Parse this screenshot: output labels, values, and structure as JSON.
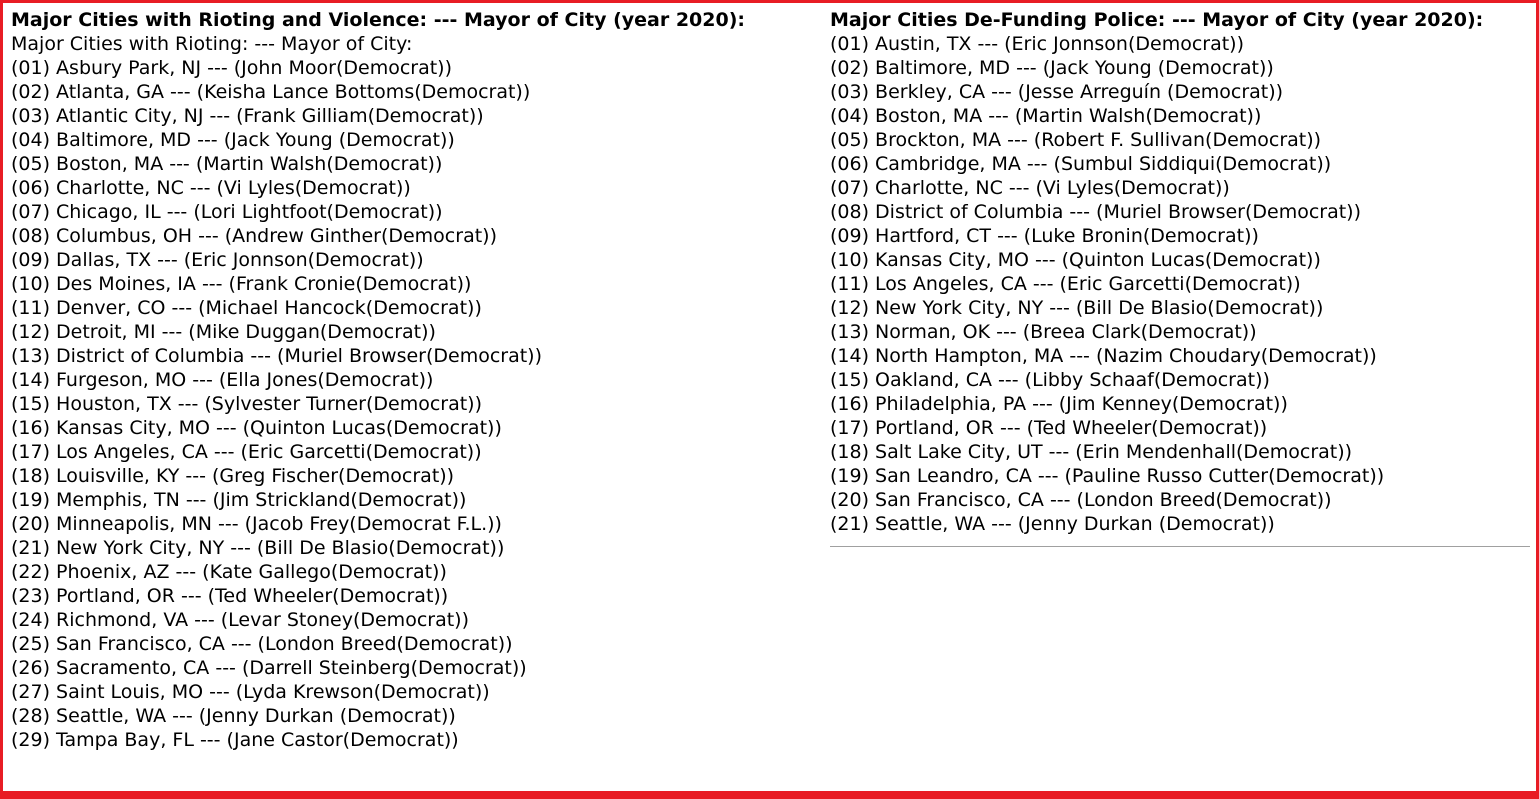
{
  "colors": {
    "frame_border": "#e81c24",
    "divider": "#a0a0a0"
  },
  "left": {
    "heading": "Major Cities with Rioting and Violence: --- Mayor of City (year 2020):",
    "subheading": "Major Cities with Rioting: --- Mayor of City:",
    "items": [
      "(01) Asbury Park, NJ --- (John Moor(Democrat))",
      "(02) Atlanta, GA --- (Keisha Lance Bottoms(Democrat))",
      "(03) Atlantic City, NJ --- (Frank Gilliam(Democrat))",
      "(04) Baltimore, MD --- (Jack Young (Democrat))",
      "(05) Boston, MA --- (Martin Walsh(Democrat))",
      "(06) Charlotte, NC --- (Vi Lyles(Democrat))",
      "(07) Chicago, IL --- (Lori Lightfoot(Democrat))",
      "(08) Columbus, OH --- (Andrew Ginther(Democrat))",
      "(09) Dallas, TX --- (Eric Jonnson(Democrat))",
      "(10) Des Moines, IA --- (Frank Cronie(Democrat))",
      "(11) Denver, CO --- (Michael Hancock(Democrat))",
      "(12) Detroit, MI --- (Mike Duggan(Democrat))",
      "(13) District of Columbia --- (Muriel Browser(Democrat))",
      "(14) Furgeson, MO --- (Ella Jones(Democrat))",
      "(15) Houston, TX --- (Sylvester Turner(Democrat))",
      "(16) Kansas City, MO --- (Quinton Lucas(Democrat))",
      "(17) Los Angeles, CA --- (Eric Garcetti(Democrat))",
      "(18) Louisville, KY --- (Greg Fischer(Democrat))",
      "(19) Memphis, TN --- (Jim Strickland(Democrat))",
      "(20) Minneapolis, MN --- (Jacob Frey(Democrat F.L.))",
      "(21) New York City, NY --- (Bill De Blasio(Democrat))",
      "(22) Phoenix, AZ --- (Kate Gallego(Democrat))",
      "(23) Portland, OR --- (Ted Wheeler(Democrat))",
      "(24) Richmond, VA --- (Levar Stoney(Democrat))",
      "(25) San Francisco, CA --- (London Breed(Democrat))",
      "(26) Sacramento, CA --- (Darrell Steinberg(Democrat))",
      "(27) Saint Louis, MO --- (Lyda Krewson(Democrat))",
      "(28) Seattle, WA --- (Jenny Durkan (Democrat))",
      "(29) Tampa Bay, FL --- (Jane Castor(Democrat))"
    ]
  },
  "right": {
    "heading": "Major Cities De-Funding Police: --- Mayor of City (year 2020):",
    "items": [
      "(01) Austin, TX --- (Eric Jonnson(Democrat))",
      "(02) Baltimore, MD --- (Jack Young (Democrat))",
      "(03) Berkley, CA --- (Jesse Arreguín (Democrat))",
      "(04) Boston, MA --- (Martin Walsh(Democrat))",
      "(05) Brockton, MA --- (Robert F. Sullivan(Democrat))",
      "(06) Cambridge, MA --- (Sumbul Siddiqui(Democrat))",
      "(07) Charlotte, NC --- (Vi Lyles(Democrat))",
      "(08) District of Columbia --- (Muriel Browser(Democrat))",
      "(09) Hartford, CT --- (Luke Bronin(Democrat))",
      "(10) Kansas City, MO --- (Quinton Lucas(Democrat))",
      "(11) Los Angeles, CA --- (Eric Garcetti(Democrat))",
      "(12) New York City, NY --- (Bill De Blasio(Democrat))",
      "(13) Norman, OK --- (Breea Clark(Democrat))",
      "(14) North Hampton, MA --- (Nazim Choudary(Democrat))",
      "(15) Oakland, CA --- (Libby Schaaf(Democrat))",
      "(16) Philadelphia, PA --- (Jim Kenney(Democrat))",
      "(17) Portland, OR --- (Ted Wheeler(Democrat))",
      "(18) Salt Lake City, UT --- (Erin Mendenhall(Democrat))",
      "(19) San Leandro, CA --- (Pauline Russo Cutter(Democrat))",
      "(20) San Francisco, CA --- (London Breed(Democrat))",
      "(21) Seattle, WA --- (Jenny Durkan (Democrat))"
    ]
  }
}
